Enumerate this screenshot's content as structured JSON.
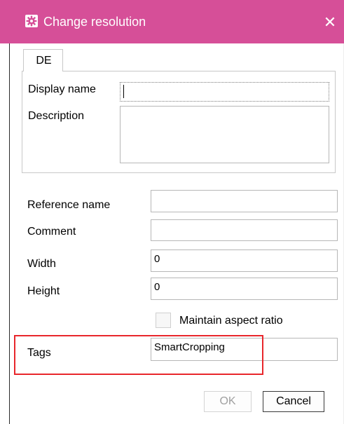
{
  "window": {
    "title": "Change resolution",
    "title_color": "#d64f98",
    "app_icon": "gear-icon",
    "close_icon": "close-icon",
    "close_glyph": "✕"
  },
  "tabs": [
    {
      "label": "DE",
      "selected": true
    }
  ],
  "localized_fields": {
    "display_name": {
      "label": "Display name",
      "value": ""
    },
    "description": {
      "label": "Description",
      "value": ""
    }
  },
  "fields": {
    "reference_name": {
      "label": "Reference name",
      "value": ""
    },
    "comment": {
      "label": "Comment",
      "value": ""
    },
    "width": {
      "label": "Width",
      "value": "0"
    },
    "height": {
      "label": "Height",
      "value": "0"
    },
    "maintain_aspect_ratio": {
      "label": "Maintain aspect ratio",
      "checked": false,
      "enabled": false
    },
    "tags": {
      "label": "Tags",
      "value": "SmartCropping"
    }
  },
  "buttons": {
    "ok": {
      "label": "OK",
      "enabled": false
    },
    "cancel": {
      "label": "Cancel",
      "enabled": true
    }
  },
  "annotation": {
    "color": "#e8262b"
  }
}
